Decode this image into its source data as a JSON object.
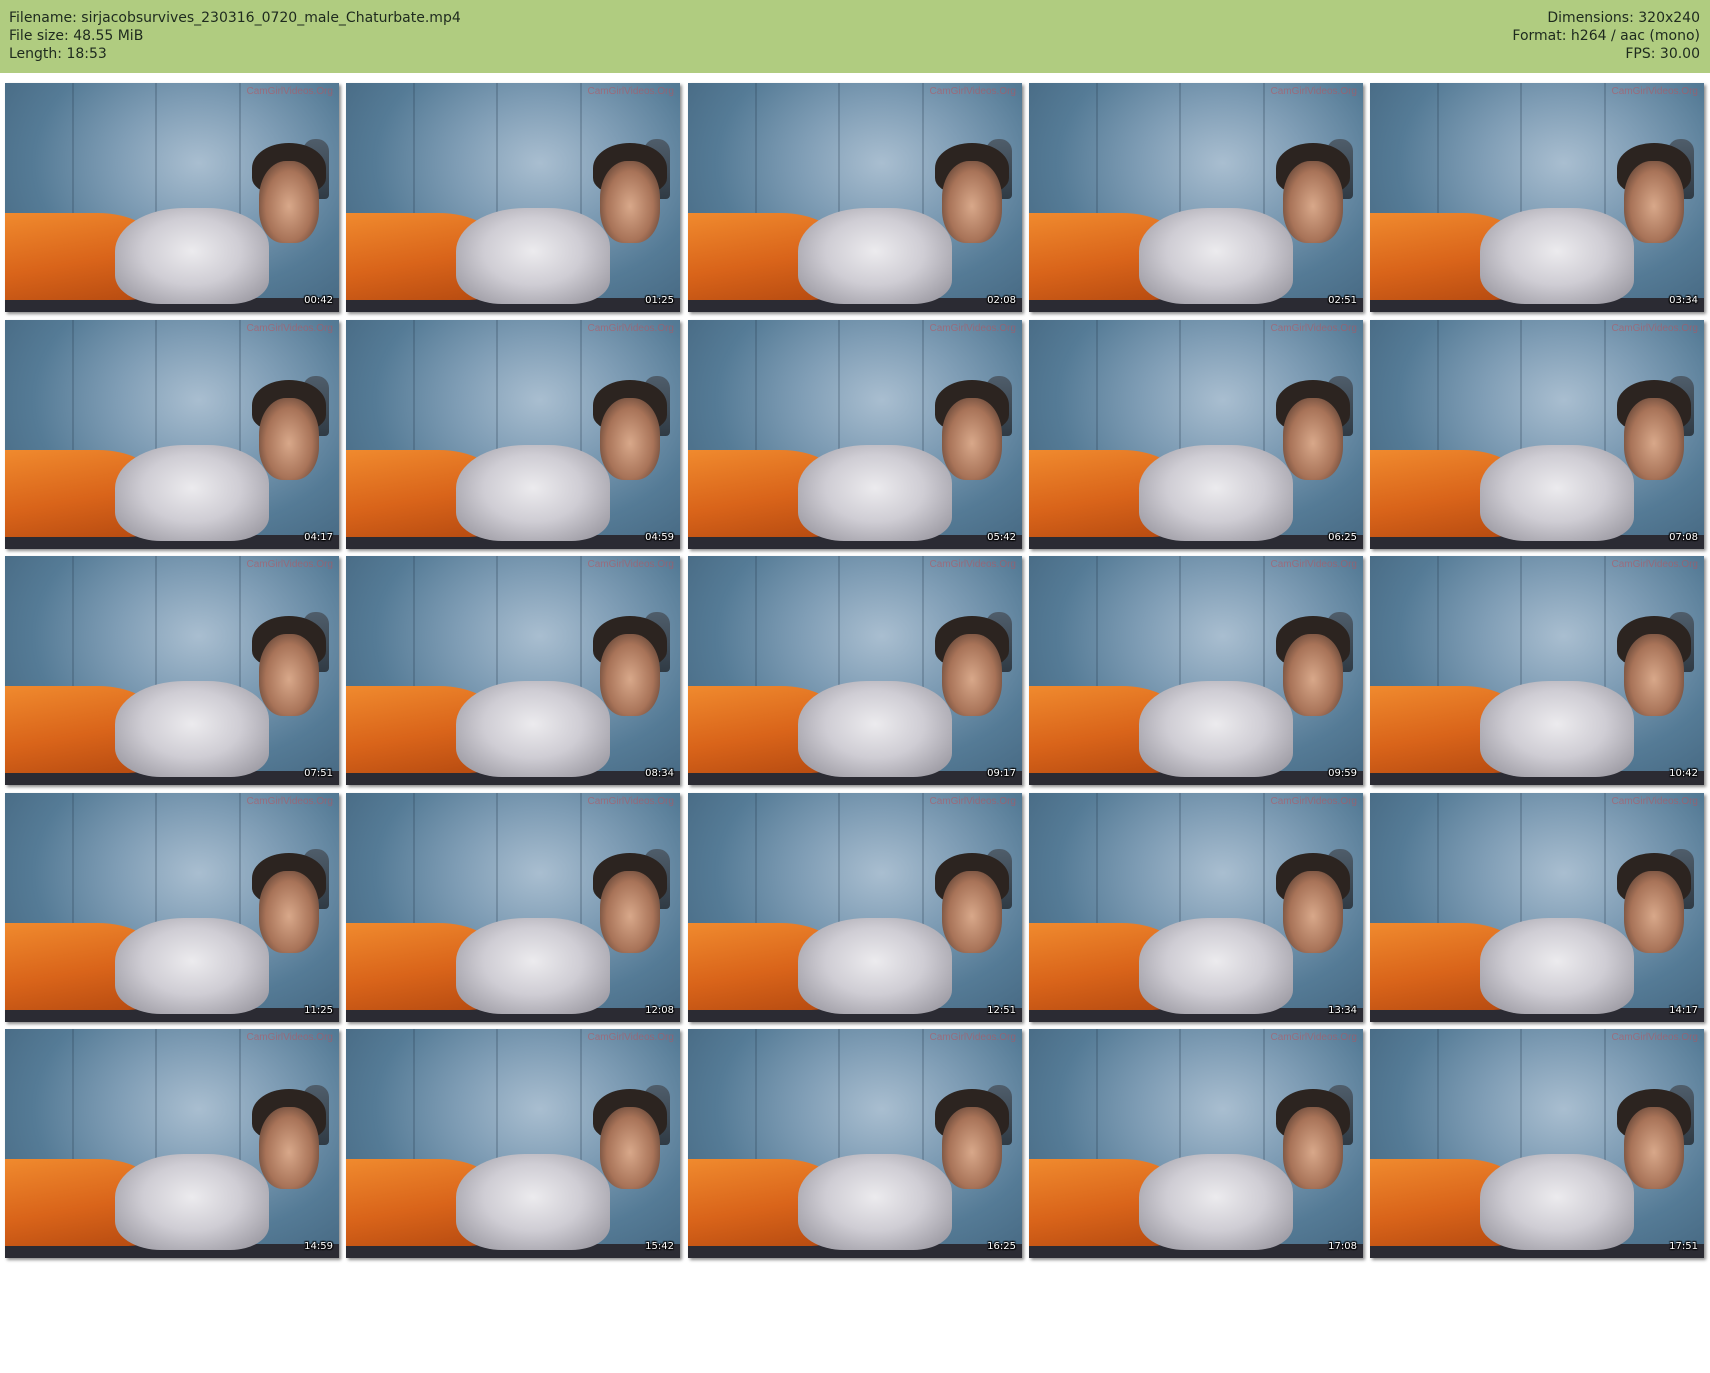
{
  "header": {
    "filename_label": "Filename: sirjacobsurvives_230316_0720_male_Chaturbate.mp4",
    "filesize_label": "File size: 48.55 MiB",
    "length_label": "Length: 18:53",
    "dimensions_label": "Dimensions: 320x240",
    "format_label": "Format: h264 / aac (mono)",
    "fps_label": "FPS: 30.00"
  },
  "watermark": "CamGirlVideos.Org",
  "thumbnails": [
    "00:42",
    "01:25",
    "02:08",
    "02:51",
    "03:34",
    "04:17",
    "04:59",
    "05:42",
    "06:25",
    "07:08",
    "07:51",
    "08:34",
    "09:17",
    "09:59",
    "10:42",
    "11:25",
    "12:08",
    "12:51",
    "13:34",
    "14:17",
    "14:59",
    "15:42",
    "16:25",
    "17:08",
    "17:51"
  ],
  "colors": {
    "header_bg": "#b0cc80",
    "sheet_orange": "#e8772a",
    "wall_blue": "#6d8ca6"
  }
}
